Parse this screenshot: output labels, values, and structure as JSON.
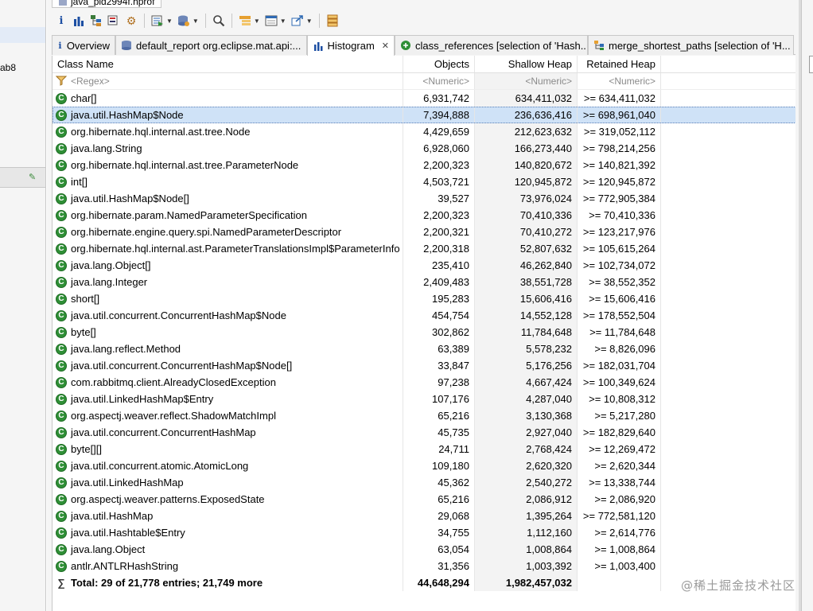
{
  "window": {
    "title": "java_pid2994f.hprof"
  },
  "left_panel": {
    "text": "ab8"
  },
  "toolbar": {
    "items": [
      {
        "icon": "info-icon"
      },
      {
        "icon": "histogram-icon"
      },
      {
        "icon": "dominator-tree-icon"
      },
      {
        "icon": "query-icon"
      },
      {
        "icon": "settings-icon"
      },
      {
        "icon": "run-report-icon"
      },
      {
        "icon": "heap-dump-icon"
      },
      {
        "icon": "search-icon"
      },
      {
        "icon": "group-icon"
      },
      {
        "icon": "calculate-icon"
      },
      {
        "icon": "export-icon"
      },
      {
        "icon": "columns-icon"
      }
    ]
  },
  "tabs": [
    {
      "label": "Overview",
      "icon": "info-icon",
      "active": false
    },
    {
      "label": "default_report  org.eclipse.mat.api:...",
      "icon": "report-icon",
      "active": false
    },
    {
      "label": "Histogram",
      "icon": "histogram-icon",
      "active": true
    },
    {
      "label": "class_references [selection of 'Hash...",
      "icon": "references-icon",
      "active": false
    },
    {
      "label": "merge_shortest_paths [selection of 'H...",
      "icon": "paths-icon",
      "active": false
    }
  ],
  "table": {
    "headers": {
      "name": "Class Name",
      "objects": "Objects",
      "shallow": "Shallow Heap",
      "retained": "Retained Heap"
    },
    "filters": {
      "name": "<Regex>",
      "objects": "<Numeric>",
      "shallow": "<Numeric>",
      "retained": "<Numeric>"
    },
    "selected_index": 1,
    "rows": [
      {
        "name": "char[]",
        "objects": "6,931,742",
        "shallow": "634,411,032",
        "retained": ">= 634,411,032"
      },
      {
        "name": "java.util.HashMap$Node",
        "objects": "7,394,888",
        "shallow": "236,636,416",
        "retained": ">= 698,961,040"
      },
      {
        "name": "org.hibernate.hql.internal.ast.tree.Node",
        "objects": "4,429,659",
        "shallow": "212,623,632",
        "retained": ">= 319,052,112"
      },
      {
        "name": "java.lang.String",
        "objects": "6,928,060",
        "shallow": "166,273,440",
        "retained": ">= 798,214,256"
      },
      {
        "name": "org.hibernate.hql.internal.ast.tree.ParameterNode",
        "objects": "2,200,323",
        "shallow": "140,820,672",
        "retained": ">= 140,821,392"
      },
      {
        "name": "int[]",
        "objects": "4,503,721",
        "shallow": "120,945,872",
        "retained": ">= 120,945,872"
      },
      {
        "name": "java.util.HashMap$Node[]",
        "objects": "39,527",
        "shallow": "73,976,024",
        "retained": ">= 772,905,384"
      },
      {
        "name": "org.hibernate.param.NamedParameterSpecification",
        "objects": "2,200,323",
        "shallow": "70,410,336",
        "retained": ">= 70,410,336"
      },
      {
        "name": "org.hibernate.engine.query.spi.NamedParameterDescriptor",
        "objects": "2,200,321",
        "shallow": "70,410,272",
        "retained": ">= 123,217,976"
      },
      {
        "name": "org.hibernate.hql.internal.ast.ParameterTranslationsImpl$ParameterInfo",
        "objects": "2,200,318",
        "shallow": "52,807,632",
        "retained": ">= 105,615,264"
      },
      {
        "name": "java.lang.Object[]",
        "objects": "235,410",
        "shallow": "46,262,840",
        "retained": ">= 102,734,072"
      },
      {
        "name": "java.lang.Integer",
        "objects": "2,409,483",
        "shallow": "38,551,728",
        "retained": ">= 38,552,352"
      },
      {
        "name": "short[]",
        "objects": "195,283",
        "shallow": "15,606,416",
        "retained": ">= 15,606,416"
      },
      {
        "name": "java.util.concurrent.ConcurrentHashMap$Node",
        "objects": "454,754",
        "shallow": "14,552,128",
        "retained": ">= 178,552,504"
      },
      {
        "name": "byte[]",
        "objects": "302,862",
        "shallow": "11,784,648",
        "retained": ">= 11,784,648"
      },
      {
        "name": "java.lang.reflect.Method",
        "objects": "63,389",
        "shallow": "5,578,232",
        "retained": ">= 8,826,096"
      },
      {
        "name": "java.util.concurrent.ConcurrentHashMap$Node[]",
        "objects": "33,847",
        "shallow": "5,176,256",
        "retained": ">= 182,031,704"
      },
      {
        "name": "com.rabbitmq.client.AlreadyClosedException",
        "objects": "97,238",
        "shallow": "4,667,424",
        "retained": ">= 100,349,624"
      },
      {
        "name": "java.util.LinkedHashMap$Entry",
        "objects": "107,176",
        "shallow": "4,287,040",
        "retained": ">= 10,808,312"
      },
      {
        "name": "org.aspectj.weaver.reflect.ShadowMatchImpl",
        "objects": "65,216",
        "shallow": "3,130,368",
        "retained": ">= 5,217,280"
      },
      {
        "name": "java.util.concurrent.ConcurrentHashMap",
        "objects": "45,735",
        "shallow": "2,927,040",
        "retained": ">= 182,829,640"
      },
      {
        "name": "byte[][]",
        "objects": "24,711",
        "shallow": "2,768,424",
        "retained": ">= 12,269,472"
      },
      {
        "name": "java.util.concurrent.atomic.AtomicLong",
        "objects": "109,180",
        "shallow": "2,620,320",
        "retained": ">= 2,620,344"
      },
      {
        "name": "java.util.LinkedHashMap",
        "objects": "45,362",
        "shallow": "2,540,272",
        "retained": ">= 13,338,744"
      },
      {
        "name": "org.aspectj.weaver.patterns.ExposedState",
        "objects": "65,216",
        "shallow": "2,086,912",
        "retained": ">= 2,086,920"
      },
      {
        "name": "java.util.HashMap",
        "objects": "29,068",
        "shallow": "1,395,264",
        "retained": ">= 772,581,120"
      },
      {
        "name": "java.util.Hashtable$Entry",
        "objects": "34,755",
        "shallow": "1,112,160",
        "retained": ">= 2,614,776"
      },
      {
        "name": "java.lang.Object",
        "objects": "63,054",
        "shallow": "1,008,864",
        "retained": ">= 1,008,864"
      },
      {
        "name": "antlr.ANTLRHashString",
        "objects": "31,356",
        "shallow": "1,003,392",
        "retained": ">= 1,003,400"
      }
    ],
    "total": {
      "label": "Total: 29 of 21,778 entries; 21,749 more",
      "objects": "44,648,294",
      "shallow": "1,982,457,032",
      "retained": ""
    }
  },
  "watermark": "@稀土掘金技术社区",
  "colors": {
    "class_icon": "#2f8f36",
    "selection": "#cfe2f7"
  }
}
